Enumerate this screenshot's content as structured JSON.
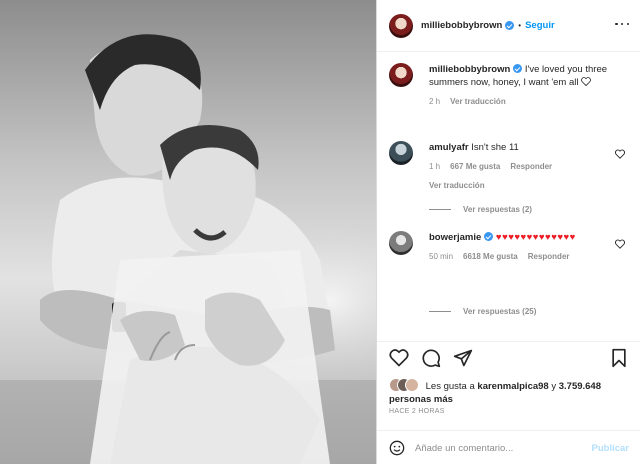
{
  "post": {
    "username": "milliebobbybrown",
    "follow_label": "Seguir",
    "separator": "•",
    "caption": "I've loved you three summers now, honey, I want 'em all",
    "caption_age": "2 h",
    "translate_label": "Ver traducción"
  },
  "comments": [
    {
      "username": "amulyafr",
      "text": "Isn't she 11",
      "age": "1 h",
      "likes": "667 Me gusta",
      "reply_label": "Responder",
      "translate_label": "Ver traducción",
      "view_replies": "Ver respuestas (2)"
    },
    {
      "username": "bowerjamie",
      "text": "♥♥♥♥♥♥♥♥♥♥♥♥♥",
      "age": "50 min",
      "likes": "6618 Me gusta",
      "reply_label": "Responder",
      "view_replies": "Ver respuestas (25)"
    }
  ],
  "likes": {
    "prefix": "Les gusta a",
    "user": "karenmalpica98",
    "middle": "y",
    "count": "3.759.648 personas más"
  },
  "timestamp": "HACE 2 HORAS",
  "composer": {
    "placeholder": "Añade un comentario...",
    "publish_label": "Publicar"
  },
  "colors": {
    "accent": "#0095f6",
    "verified": "#3897f0",
    "heart": "#ed1b24",
    "muted": "#8e8e8e"
  },
  "icons": [
    "more-options-icon",
    "verified-badge-icon",
    "heart-icon",
    "comment-icon",
    "share-icon",
    "save-icon",
    "emoji-icon"
  ]
}
